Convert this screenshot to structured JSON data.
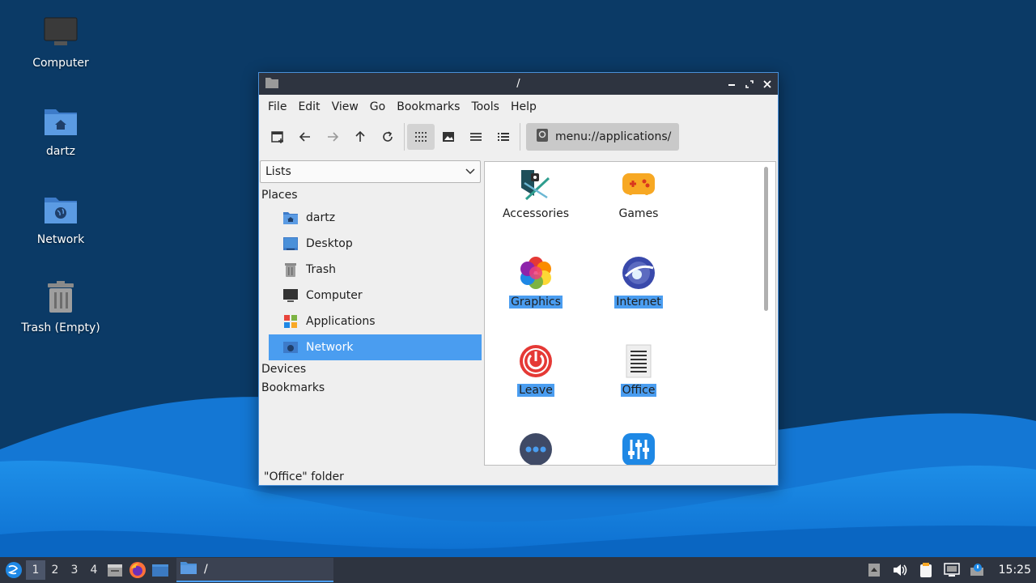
{
  "desktop": {
    "icons": [
      {
        "label": "Computer"
      },
      {
        "label": "dartz"
      },
      {
        "label": "Network"
      },
      {
        "label": "Trash (Empty)"
      }
    ]
  },
  "window": {
    "title": "/",
    "menu": [
      "File",
      "Edit",
      "View",
      "Go",
      "Bookmarks",
      "Tools",
      "Help"
    ],
    "location": "menu://applications/",
    "side_pane": {
      "mode_selector": "Lists",
      "places_header": "Places",
      "places": [
        {
          "label": "dartz",
          "icon": "home-folder-icon"
        },
        {
          "label": "Desktop",
          "icon": "desktop-icon"
        },
        {
          "label": "Trash",
          "icon": "trash-icon"
        },
        {
          "label": "Computer",
          "icon": "computer-icon"
        },
        {
          "label": "Applications",
          "icon": "applications-icon"
        },
        {
          "label": "Network",
          "icon": "network-icon",
          "selected": true
        }
      ],
      "devices_header": "Devices",
      "bookmarks_header": "Bookmarks"
    },
    "apps": [
      {
        "label": "Accessories",
        "icon": "accessories-icon"
      },
      {
        "label": "Games",
        "icon": "games-icon"
      },
      {
        "label": "Graphics",
        "icon": "graphics-icon",
        "selected": true
      },
      {
        "label": "Internet",
        "icon": "internet-icon",
        "selected": true
      },
      {
        "label": "Leave",
        "icon": "power-icon",
        "selected": true
      },
      {
        "label": "Office",
        "icon": "office-icon",
        "selected": true
      },
      {
        "label": "",
        "icon": "more-icon"
      },
      {
        "label": "",
        "icon": "settings-icon"
      }
    ],
    "status": "\"Office\" folder"
  },
  "taskbar": {
    "workspaces": [
      "1",
      "2",
      "3",
      "4"
    ],
    "active_workspace": "1",
    "task_title": "/",
    "clock": "15:25"
  },
  "colors": {
    "accent": "#4a9df0",
    "titlebar": "#2e3440",
    "desktop_bg": "#0b3a66"
  }
}
